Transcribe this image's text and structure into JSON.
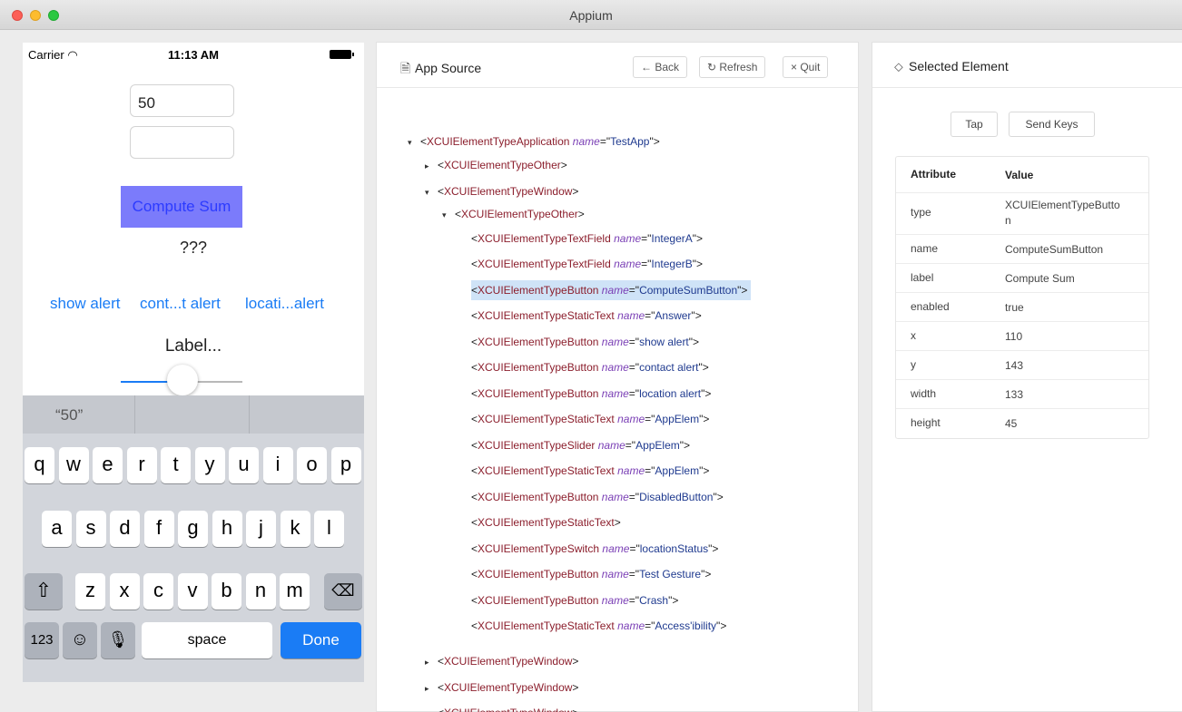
{
  "window": {
    "title": "Appium"
  },
  "device": {
    "status": {
      "carrier": "Carrier",
      "time": "11:13 AM"
    },
    "fields": {
      "integer_a": "50",
      "integer_b": ""
    },
    "compute_button": "Compute Sum",
    "answer": "???",
    "links": [
      "show alert",
      "cont...t alert",
      "locati...alert"
    ],
    "label": "Label...",
    "slider_value": 0.5,
    "keyboard": {
      "prediction": "“50”",
      "row1": [
        "q",
        "w",
        "e",
        "r",
        "t",
        "y",
        "u",
        "i",
        "o",
        "p"
      ],
      "row2": [
        "a",
        "s",
        "d",
        "f",
        "g",
        "h",
        "j",
        "k",
        "l"
      ],
      "row3": [
        "z",
        "x",
        "c",
        "v",
        "b",
        "n",
        "m"
      ],
      "numbers_key": "123",
      "space_key": "space",
      "done_key": "Done"
    }
  },
  "source": {
    "title": "App Source",
    "buttons": {
      "back": "← Back",
      "refresh": "↻ Refresh",
      "quit": "× Quit"
    },
    "tree": [
      {
        "toggle": "▾",
        "tag": "XCUIElementTypeApplication",
        "attr": "name",
        "value": "TestApp"
      },
      {
        "toggle": "▸",
        "tag": "XCUIElementTypeOther",
        "attr": "",
        "value": ""
      },
      {
        "toggle": "▾",
        "tag": "XCUIElementTypeWindow",
        "attr": "",
        "value": ""
      },
      {
        "toggle": "▾",
        "tag": "XCUIElementTypeOther",
        "attr": "",
        "value": ""
      },
      {
        "toggle": "",
        "tag": "XCUIElementTypeTextField",
        "attr": "name",
        "value": "IntegerA"
      },
      {
        "toggle": "",
        "tag": "XCUIElementTypeTextField",
        "attr": "name",
        "value": "IntegerB"
      },
      {
        "toggle": "",
        "tag": "XCUIElementTypeButton",
        "attr": "name",
        "value": "ComputeSumButton"
      },
      {
        "toggle": "",
        "tag": "XCUIElementTypeStaticText",
        "attr": "name",
        "value": "Answer"
      },
      {
        "toggle": "",
        "tag": "XCUIElementTypeButton",
        "attr": "name",
        "value": "show alert"
      },
      {
        "toggle": "",
        "tag": "XCUIElementTypeButton",
        "attr": "name",
        "value": "contact alert"
      },
      {
        "toggle": "",
        "tag": "XCUIElementTypeButton",
        "attr": "name",
        "value": "location alert"
      },
      {
        "toggle": "",
        "tag": "XCUIElementTypeStaticText",
        "attr": "name",
        "value": "AppElem"
      },
      {
        "toggle": "",
        "tag": "XCUIElementTypeSlider",
        "attr": "name",
        "value": "AppElem"
      },
      {
        "toggle": "",
        "tag": "XCUIElementTypeStaticText",
        "attr": "name",
        "value": "AppElem"
      },
      {
        "toggle": "",
        "tag": "XCUIElementTypeButton",
        "attr": "name",
        "value": "DisabledButton"
      },
      {
        "toggle": "",
        "tag": "XCUIElementTypeStaticText",
        "attr": "",
        "value": ""
      },
      {
        "toggle": "",
        "tag": "XCUIElementTypeSwitch",
        "attr": "name",
        "value": "locationStatus"
      },
      {
        "toggle": "",
        "tag": "XCUIElementTypeButton",
        "attr": "name",
        "value": "Test Gesture"
      },
      {
        "toggle": "",
        "tag": "XCUIElementTypeButton",
        "attr": "name",
        "value": "Crash"
      },
      {
        "toggle": "",
        "tag": "XCUIElementTypeStaticText",
        "attr": "name",
        "value": "Access'ibility"
      },
      {
        "toggle": "▸",
        "tag": "XCUIElementTypeWindow",
        "attr": "",
        "value": ""
      },
      {
        "toggle": "▸",
        "tag": "XCUIElementTypeWindow",
        "attr": "",
        "value": ""
      },
      {
        "toggle": "▸",
        "tag": "XCUIElementTypeWindow",
        "attr": "",
        "value": ""
      }
    ],
    "selected_index": 6
  },
  "selected": {
    "title": "Selected Element",
    "buttons": {
      "tap": "Tap",
      "send_keys": "Send Keys"
    },
    "table": {
      "headers": [
        "Attribute",
        "Value"
      ],
      "rows": [
        [
          "type",
          "XCUIElementTypeButton"
        ],
        [
          "name",
          "ComputeSumButton"
        ],
        [
          "label",
          "Compute Sum"
        ],
        [
          "enabled",
          "true"
        ],
        [
          "x",
          "110"
        ],
        [
          "y",
          "143"
        ],
        [
          "width",
          "133"
        ],
        [
          "height",
          "45"
        ]
      ]
    }
  },
  "colors": {
    "accent": "#1a7cf5",
    "selection": "#cfe3f7",
    "tag": "#8b1e2c",
    "attr_name": "#7a3fb5",
    "attr_value": "#1f3a8f",
    "compute_bg": "#7b7bfb"
  }
}
